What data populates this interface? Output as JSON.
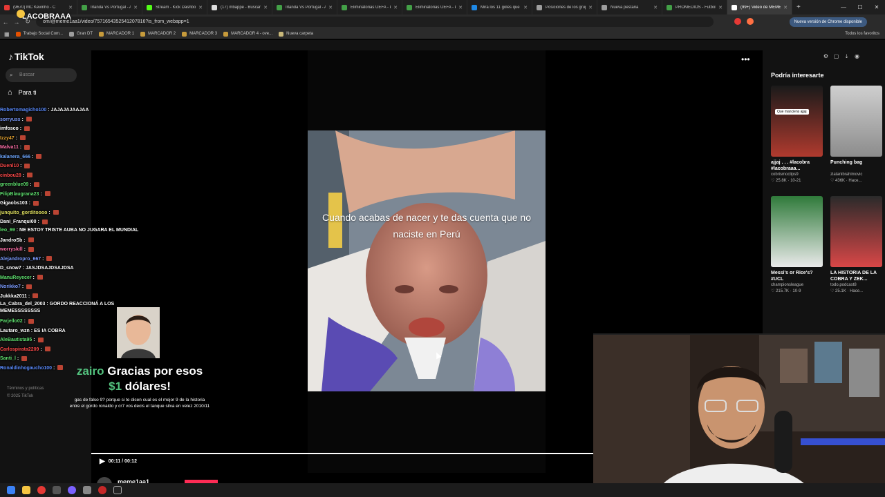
{
  "browser": {
    "tabs": [
      {
        "label": "(9670) MC Kevinho - C",
        "color": "#e53935"
      },
      {
        "label": "Irlanda Vs Portugal - A",
        "color": "#43a047"
      },
      {
        "label": "Stream - Kick Dashbo",
        "color": "#53fc18"
      },
      {
        "label": "(17) mbappe - Buscar",
        "color": "#dddddd"
      },
      {
        "label": "Irlanda Vs Portugal - A",
        "color": "#43a047"
      },
      {
        "label": "Eliminatorias UEFA - P",
        "color": "#43a047"
      },
      {
        "label": "Eliminatorias UEFA - P",
        "color": "#43a047"
      },
      {
        "label": "Mira los 11 goles que",
        "color": "#1e88e5"
      },
      {
        "label": "Posiciones de los grup",
        "color": "#9e9e9e"
      },
      {
        "label": "Nueva pestaña",
        "color": "#9e9e9e"
      },
      {
        "label": "PROMEDIOS - Futbol",
        "color": "#43a047"
      },
      {
        "label": "(99+) Video de MEME",
        "color": "#ffffff",
        "active": true
      }
    ],
    "url": "om/@meme1aa1/video/7571654352541207816?is_from_webapp=1",
    "update_label": "Nueva versión de Chrome disponible",
    "bookmarks": [
      "Trabajo Social Com...",
      "Gran DT",
      "MARCADOR 1",
      "MARCADOR 2",
      "MARCADOR 3",
      "MARCADOR 4 - ove...",
      "Nueva carpeta"
    ],
    "all_favorites": "Todos los favoritos",
    "overlay_logo": "LACOBRAAA"
  },
  "tiktok": {
    "logo": "TikTok",
    "search_placeholder": "Buscar",
    "nav_for_you": "Para ti",
    "video_caption": "Cuando acabas de nacer y te das cuenta que no naciste en Perú",
    "time": "00:11 / 00:12",
    "author": "meme1aa1",
    "suggested_title": "Podría interesarte",
    "suggestions": [
      {
        "title": "ajjaj . . . #lacobra #lacobraaa...",
        "user": "cobrismoclips9",
        "likes": "25.8K",
        "date": "10-21",
        "overlay": "Que manciens ajjaj"
      },
      {
        "title": "Punching bag",
        "user": "zlatanibrahimovic",
        "likes": "436K",
        "date": "Hace..."
      },
      {
        "title": "Messi's or Rice's? #UCL",
        "user": "championsleague",
        "likes": "215.7K",
        "date": "10-9"
      },
      {
        "title": "LA HISTORIA DE LA COBRA Y ZEK...",
        "user": "todo.podcast8",
        "likes": "25.1K",
        "date": "Hace..."
      }
    ],
    "terms": "Términos y políticas",
    "copyright": "© 2025 TikTok"
  },
  "chat": [
    {
      "user": "Robertomagicho100",
      "color": "#5b8cff",
      "msg": "JAJAJAJAAJAA"
    },
    {
      "user": "sorryuss",
      "color": "#7c9cff",
      "msg": ""
    },
    {
      "user": "imfosco",
      "color": "#ffffff",
      "msg": ""
    },
    {
      "user": "Izzy47",
      "color": "#e0a030",
      "msg": ""
    },
    {
      "user": "Malva11",
      "color": "#ff6fa8",
      "msg": ""
    },
    {
      "user": "kalanera_666",
      "color": "#6fa8ff",
      "msg": ""
    },
    {
      "user": "Duenl10",
      "color": "#ff4a4a",
      "msg": ""
    },
    {
      "user": "cinbou28",
      "color": "#ff4a4a",
      "msg": ""
    },
    {
      "user": "greenblue09",
      "color": "#5fe06f",
      "msg": ""
    },
    {
      "user": "FilipBlaugrana23",
      "color": "#5fe06f",
      "msg": ""
    },
    {
      "user": "Gigaobs103",
      "color": "#ffffff",
      "msg": ""
    },
    {
      "user": "junquito_gorditoooo",
      "color": "#e0e060",
      "msg": ""
    },
    {
      "user": "Dani_Franqui00",
      "color": "#ffffff",
      "msg": ""
    },
    {
      "user": "leo_69",
      "color": "#5fe06f",
      "msg": "NE ESTOY TRISTE AUBA NO JUGARA EL MUNDIAL"
    },
    {
      "user": "JandroSb",
      "color": "#ffffff",
      "msg": ""
    },
    {
      "user": "worryskill",
      "color": "#ff6fa8",
      "msg": ""
    },
    {
      "user": "Alejandropro_667",
      "color": "#7c9cff",
      "msg": ""
    },
    {
      "user": "D_snow7",
      "color": "#ffffff",
      "msg": "JASJDSAJDSAJDSA"
    },
    {
      "user": "ManuReyecer",
      "color": "#5fe06f",
      "msg": ""
    },
    {
      "user": "Norikko7",
      "color": "#7c9cff",
      "msg": ""
    },
    {
      "user": "Jukkka2011",
      "color": "#ffffff",
      "msg": ""
    },
    {
      "user": "La_Cabra_del_2003",
      "color": "#ffffff",
      "msg": "GORDO REACCIONÁ A LOS MEMESSSSSSSS"
    },
    {
      "user": "Farjello02",
      "color": "#5fe06f",
      "msg": ""
    },
    {
      "user": "Lautaro_wzn",
      "color": "#ffffff",
      "msg": "ES IA COBRA"
    },
    {
      "user": "AleBautista95",
      "color": "#5fe06f",
      "msg": ""
    },
    {
      "user": "Carlospirata2209",
      "color": "#ff4a4a",
      "msg": ""
    },
    {
      "user": "Santi_l",
      "color": "#5fe06f",
      "msg": ""
    },
    {
      "user": "Ronaldinhogaucho100",
      "color": "#5b8cff",
      "msg": ""
    }
  ],
  "donation": {
    "name": "zairo",
    "pre": " Gracias por esos",
    "amount": "$1",
    "post": " dólares!",
    "note": "gas de falso 9? porque si te dicen cual es el mejor 9 de la historia entre el gordo ronaldo y cr7 vos decis el tanque silva en velez 2010/11"
  }
}
